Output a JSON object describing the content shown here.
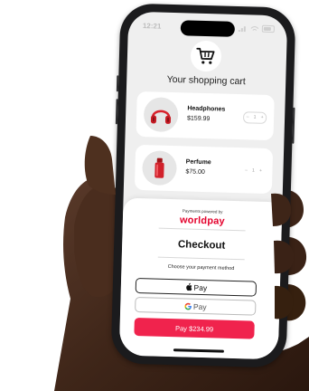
{
  "status": {
    "time": "12:21"
  },
  "cart": {
    "title": "Your shopping cart"
  },
  "items": [
    {
      "name": "Headphones",
      "price": "$159.99",
      "qty": "1",
      "minus": "–",
      "plus": "+"
    },
    {
      "name": "Perfume",
      "price": "$75.00",
      "qty": "1",
      "minus": "–",
      "plus": "+"
    }
  ],
  "checkout": {
    "powered_by": "Payments powered by",
    "brand": "worldpay",
    "heading": "Checkout",
    "choose": "Choose your payment method",
    "apple_pay": "Pay",
    "google_pay": "Pay",
    "pay_button": "Pay $234.99"
  },
  "colors": {
    "accent": "#f0234d",
    "brand": "#e4002b",
    "phone": "#1b1b1d",
    "screen": "#efefef"
  }
}
